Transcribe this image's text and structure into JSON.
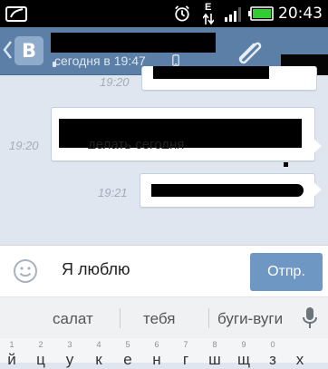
{
  "status_bar": {
    "time": "20:43",
    "network_label": "E",
    "icons": [
      "photo-icon",
      "alarm-icon",
      "data-arrows-icon",
      "signal-icon",
      "battery-icon"
    ],
    "battery_color": "#33cc33"
  },
  "header": {
    "last_seen": "сегодня в 19:47",
    "icons": [
      "back-chevron-icon",
      "vk-logo",
      "phone-icon",
      "paperclip-icon"
    ],
    "logo_letter": "В",
    "bg_color": "#5b7fa6"
  },
  "messages": [
    {
      "time": "19:20",
      "visible_text": "",
      "partial": true
    },
    {
      "time": "19:20",
      "visible_text": "делать сегодня"
    },
    {
      "time": "19:21",
      "visible_text": ""
    }
  ],
  "composer": {
    "value": "Я люблю",
    "send_label": "Отпр.",
    "send_color": "#6f97c4"
  },
  "keyboard": {
    "suggestions": [
      "салат",
      "тебя",
      "буги-вуги"
    ],
    "row_numbers": [
      "1",
      "2",
      "3",
      "4",
      "5",
      "6",
      "7",
      "8",
      "9",
      "0"
    ],
    "row_letters": [
      "й",
      "ц",
      "у",
      "к",
      "е",
      "н",
      "г",
      "ш",
      "щ",
      "з",
      "х"
    ]
  }
}
